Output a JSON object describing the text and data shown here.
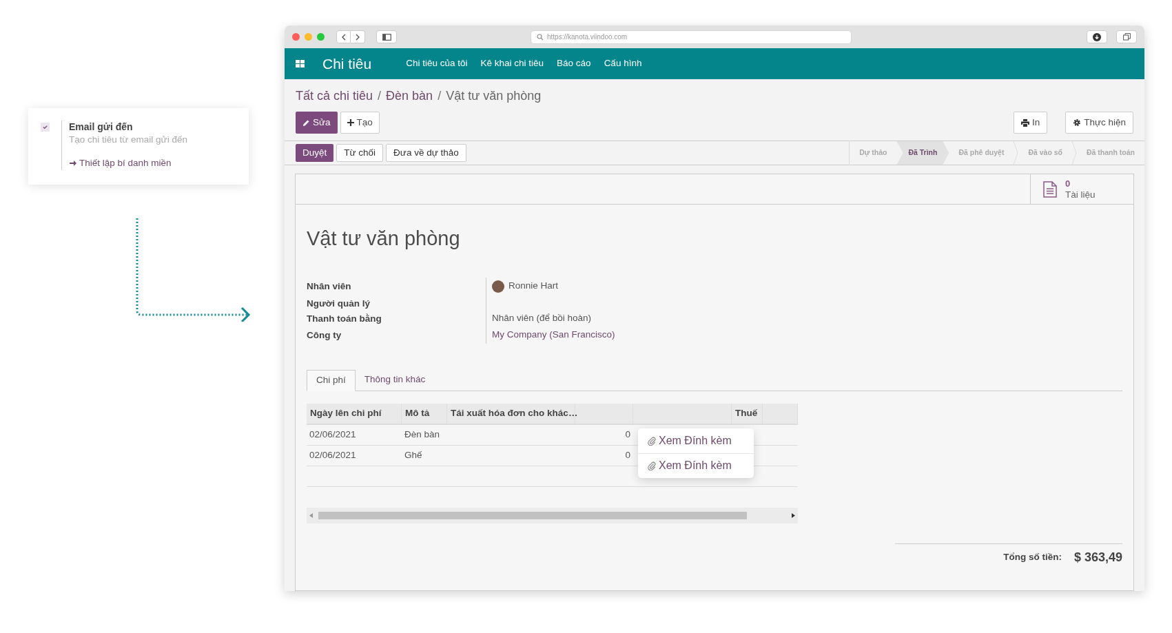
{
  "setting_card": {
    "checked": true,
    "title": "Email gửi đến",
    "description": "Tạo chi tiêu từ email gửi đến",
    "link": "Thiết lập bí danh miền"
  },
  "browser": {
    "url": "https://kanota.viindoo.com"
  },
  "navbar": {
    "app_title": "Chi tiêu",
    "menu": [
      "Chi tiêu của tôi",
      "Kê khai chi tiêu",
      "Báo cáo",
      "Cấu hình"
    ]
  },
  "breadcrumb": {
    "separator": "/",
    "items": [
      "Tất cả chi tiêu",
      "Đèn bàn",
      "Vật tư văn phòng"
    ]
  },
  "actions": {
    "edit": "Sửa",
    "create": "Tạo",
    "print": "In",
    "action": "Thực hiện"
  },
  "state_buttons": [
    {
      "label": "Duyệt",
      "primary": true
    },
    {
      "label": "Từ chối",
      "primary": false
    },
    {
      "label": "Đưa về dự thảo",
      "primary": false
    }
  ],
  "stages": [
    {
      "label": "Dự thảo",
      "selected": false
    },
    {
      "label": "Đã Trình",
      "selected": true
    },
    {
      "label": "Đã phê duyệt",
      "selected": false
    },
    {
      "label": "Đã vào sổ",
      "selected": false
    },
    {
      "label": "Đã thanh toán",
      "selected": false
    }
  ],
  "smart_button": {
    "count": "0",
    "label": "Tài liệu"
  },
  "title": "Vật tư văn phòng",
  "fields": [
    {
      "label": "Nhân viên",
      "kind": "person",
      "value": "Ronnie Hart"
    },
    {
      "label": "Người quản lý",
      "kind": "text"
    },
    {
      "label": "Thanh toán bằng",
      "kind": "text",
      "value": "Nhân viên (để bồi hoàn)"
    },
    {
      "label": "Công ty",
      "kind": "link",
      "value": "My Company (San Francisco)"
    }
  ],
  "tabs": [
    {
      "label": "Chi phí",
      "selected": true
    },
    {
      "label": "Thông tin khác",
      "selected": false
    }
  ],
  "table": {
    "columns": [
      "Ngày lên chi phí",
      "Mô tả",
      "Tái xuất hóa đơn cho khác…",
      "Thuế"
    ],
    "rows": [
      {
        "date": "02/06/2021",
        "description": "Đèn bàn",
        "column_4": "0"
      },
      {
        "date": "02/06/2021",
        "description": "Ghế",
        "column_4": "0"
      }
    ]
  },
  "attachment_popup": [
    "Xem Đính kèm",
    "Xem Đính kèm"
  ],
  "total": {
    "label": "Tổng số tiền:",
    "value": "$ 363,49"
  }
}
